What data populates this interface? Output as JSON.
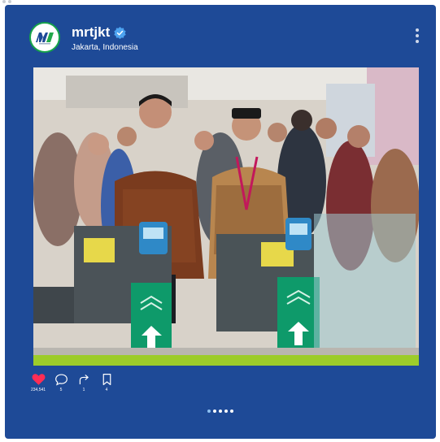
{
  "post": {
    "username": "mrtjkt",
    "location": "Jakarta, Indonesia",
    "verified": true,
    "avatar_text": "MRT",
    "accent_color": "#1e4a97"
  },
  "actions": {
    "likes": "234,541",
    "comments": "5",
    "shares": "1",
    "saves": "4"
  },
  "icons": [
    "heart-icon",
    "comment-icon",
    "share-icon",
    "bookmark-icon",
    "more-icon",
    "verified-badge-icon"
  ],
  "carousel": {
    "total": 5,
    "active_index": 0
  }
}
